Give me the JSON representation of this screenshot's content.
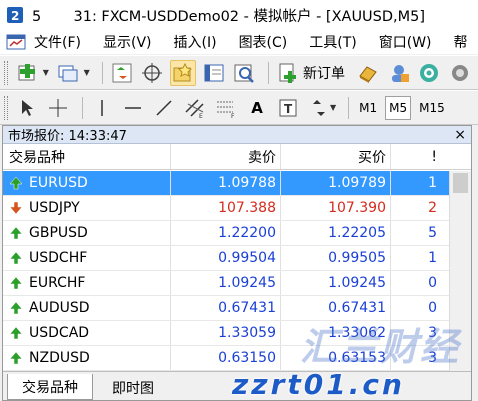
{
  "window": {
    "title": "5       31: FXCM-USDDemo02 - 模拟帐户 - [XAUUSD,M5]"
  },
  "menu": {
    "items": [
      {
        "label": "文件(F)"
      },
      {
        "label": "显示(V)"
      },
      {
        "label": "插入(I)"
      },
      {
        "label": "图表(C)"
      },
      {
        "label": "工具(T)"
      },
      {
        "label": "窗口(W)"
      },
      {
        "label": "帮"
      }
    ]
  },
  "toolbar1": {
    "new_order_label": "新订单"
  },
  "toolbar2": {
    "text_tool_label": "A",
    "trade_tool_label": "T",
    "periods": [
      "M1",
      "M5",
      "M15"
    ],
    "selected_period": "M5"
  },
  "market_watch": {
    "title": "市场报价: 14:33:47",
    "close_label": "×",
    "columns": {
      "symbol": "交易品种",
      "bid": "卖价",
      "ask": "买价",
      "spread": "!"
    },
    "rows": [
      {
        "symbol": "EURUSD",
        "bid": "1.09788",
        "ask": "1.09789",
        "spread": "1",
        "dir": "up",
        "selected": true
      },
      {
        "symbol": "USDJPY",
        "bid": "107.388",
        "ask": "107.390",
        "spread": "2",
        "dir": "down",
        "selected": false
      },
      {
        "symbol": "GBPUSD",
        "bid": "1.22200",
        "ask": "1.22205",
        "spread": "5",
        "dir": "up",
        "selected": false
      },
      {
        "symbol": "USDCHF",
        "bid": "0.99504",
        "ask": "0.99505",
        "spread": "1",
        "dir": "up",
        "selected": false
      },
      {
        "symbol": "EURCHF",
        "bid": "1.09245",
        "ask": "1.09245",
        "spread": "0",
        "dir": "up",
        "selected": false
      },
      {
        "symbol": "AUDUSD",
        "bid": "0.67431",
        "ask": "0.67431",
        "spread": "0",
        "dir": "up",
        "selected": false
      },
      {
        "symbol": "USDCAD",
        "bid": "1.33059",
        "ask": "1.33062",
        "spread": "3",
        "dir": "up",
        "selected": false
      },
      {
        "symbol": "NZDUSD",
        "bid": "0.63150",
        "ask": "0.63153",
        "spread": "3",
        "dir": "up",
        "selected": false
      }
    ],
    "tabs": [
      {
        "label": "交易品种",
        "active": true
      },
      {
        "label": "即时图",
        "active": false
      }
    ]
  },
  "colors": {
    "up_price": "#1a3fd6",
    "down_price": "#d52b1e",
    "selected_row": "#3399ff",
    "up_arrow": "#2aa02a",
    "down_arrow": "#d9531e"
  },
  "watermark": {
    "text1": "汇兰财经",
    "text2": "zzrt01.cn"
  }
}
